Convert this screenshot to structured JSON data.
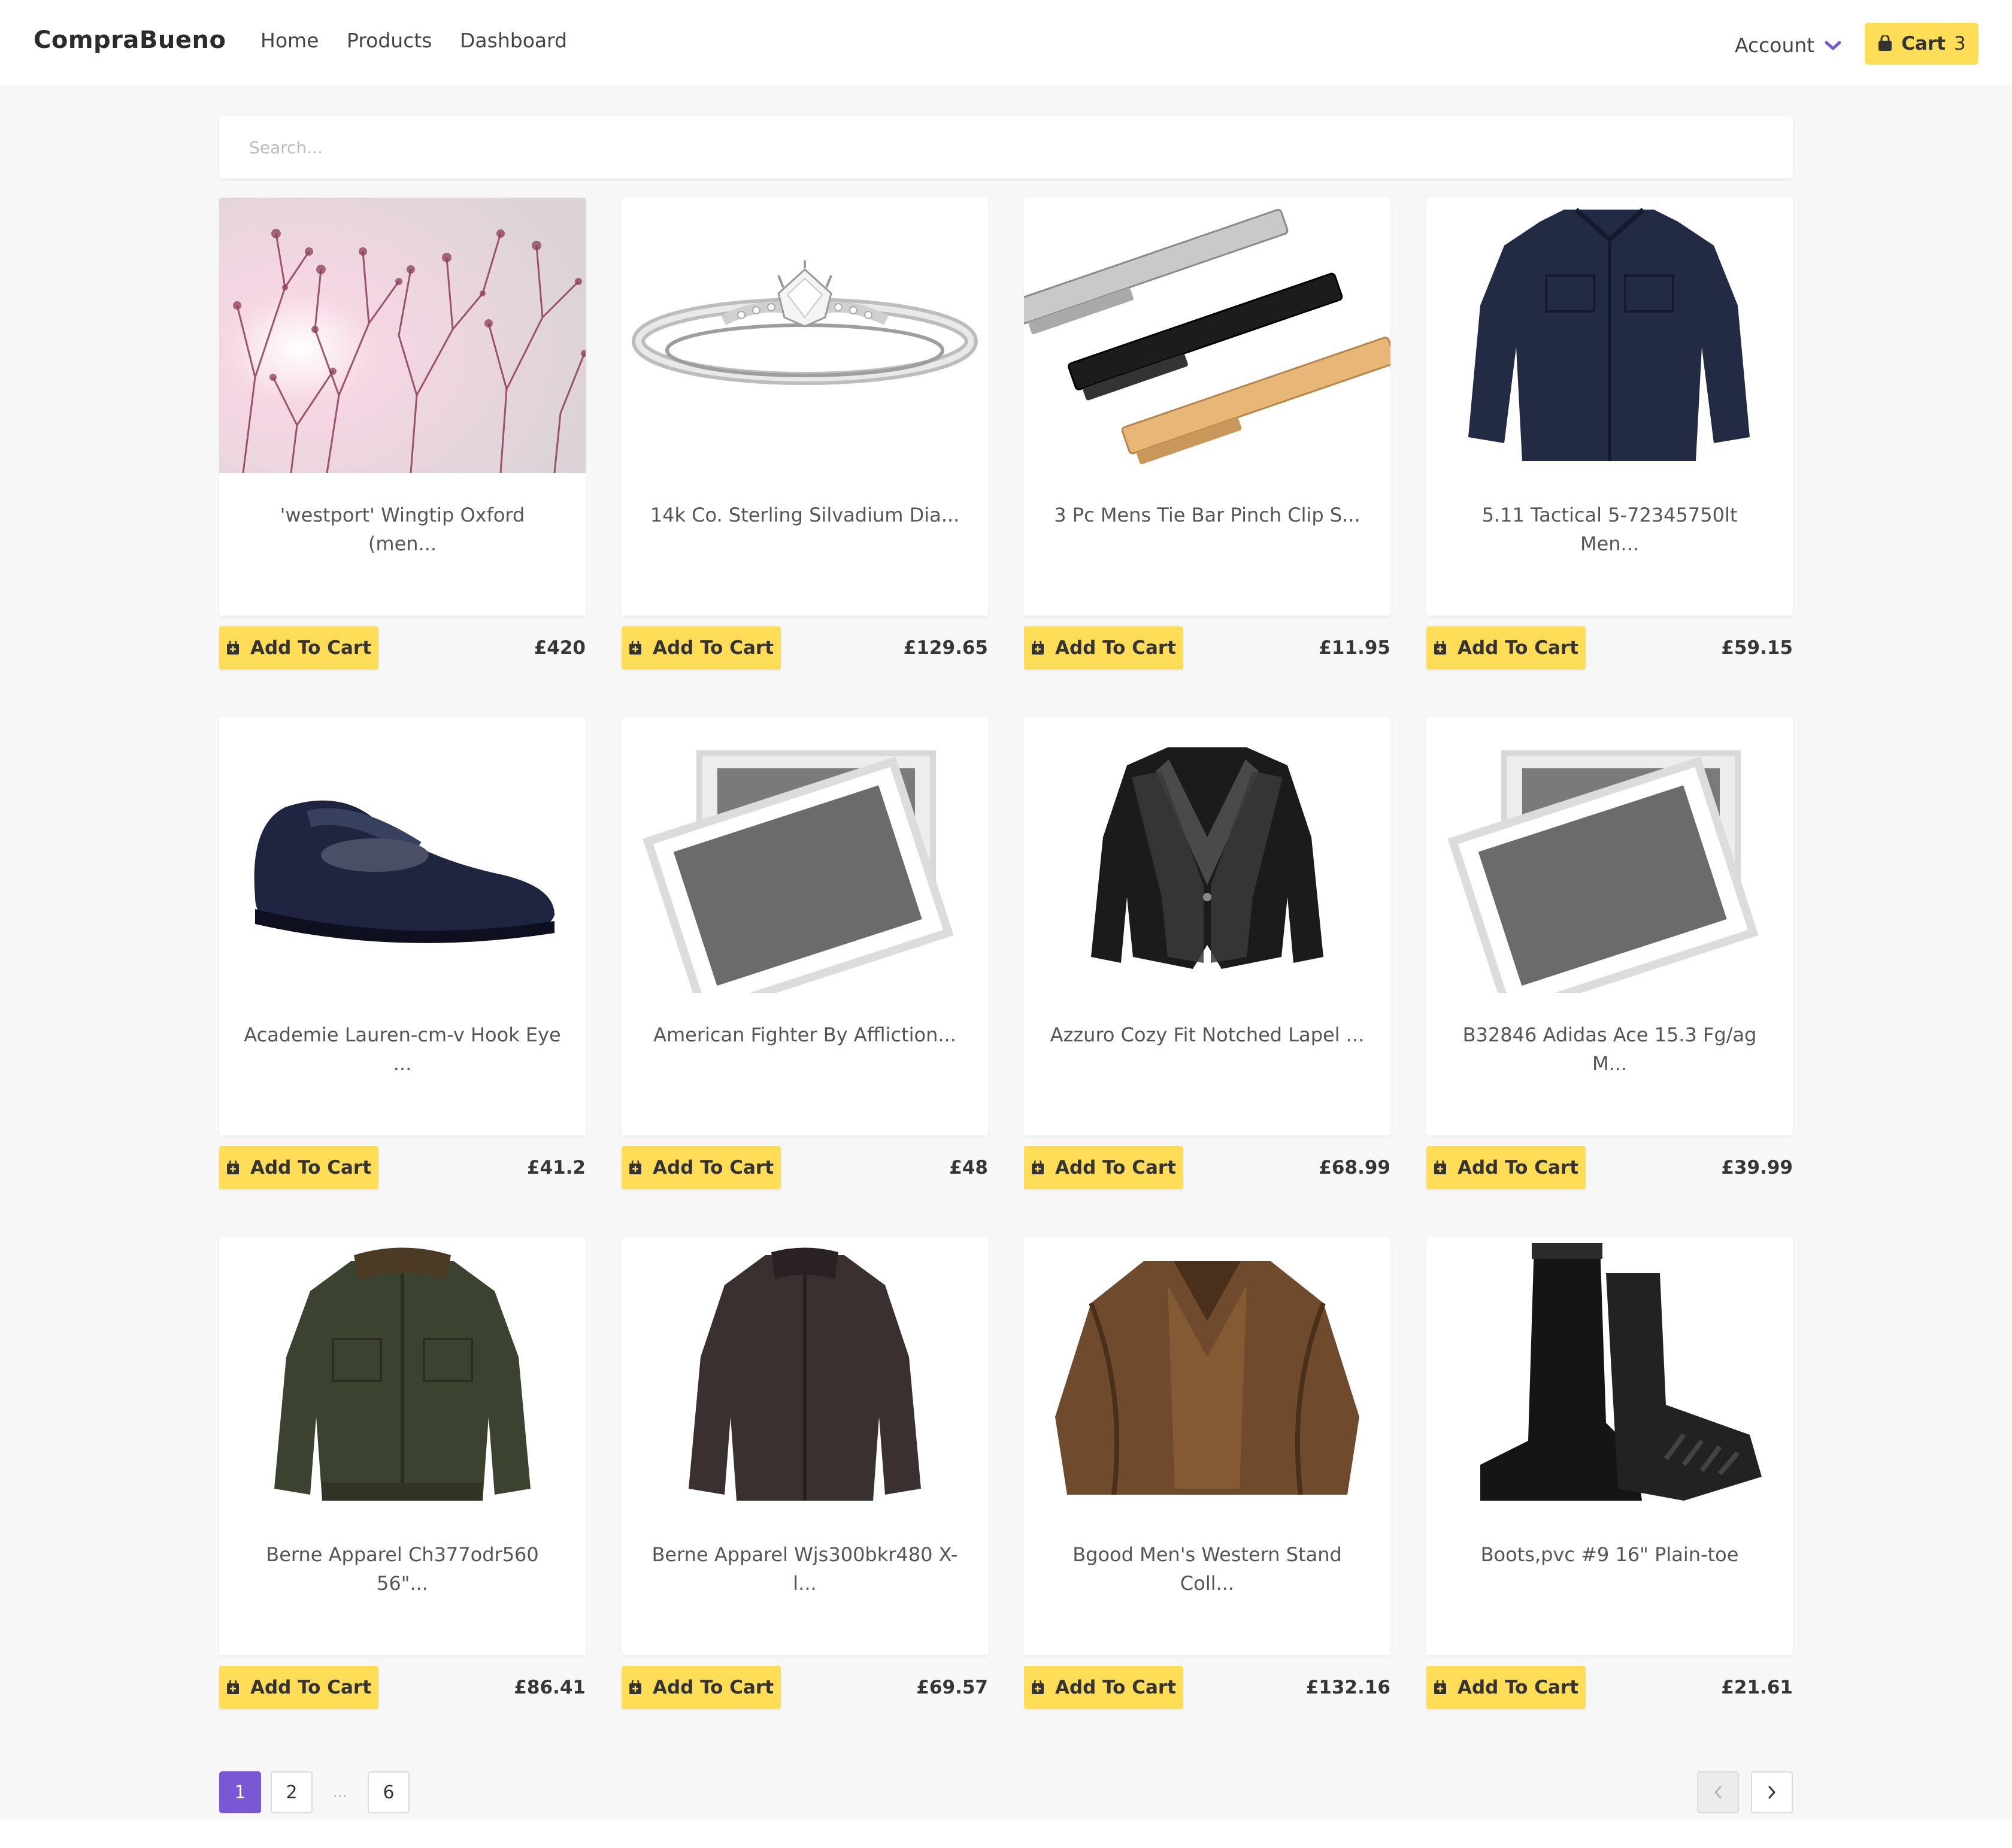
{
  "nav": {
    "brand": "CompraBueno",
    "links": [
      "Home",
      "Products",
      "Dashboard"
    ],
    "account_label": "Account",
    "cart_label": "Cart",
    "cart_count": "3",
    "accent_color": "#7957d5",
    "button_color": "#ffdd57"
  },
  "search": {
    "placeholder": "Search..."
  },
  "add_to_cart_label": "Add To Cart",
  "products": [
    {
      "title": "'westport' Wingtip Oxford (men...",
      "price": "£420",
      "image": "pink-branches-photo"
    },
    {
      "title": "14k Co. Sterling Silvadium Dia...",
      "price": "£129.65",
      "image": "diamond-ring"
    },
    {
      "title": "3 Pc Mens Tie Bar Pinch Clip S...",
      "price": "£11.95",
      "image": "tie-bars"
    },
    {
      "title": "5.11 Tactical 5-72345750lt Men...",
      "price": "£59.15",
      "image": "navy-shirt"
    },
    {
      "title": "Academie Lauren-cm-v Hook Eye ...",
      "price": "£41.2",
      "image": "navy-shoe"
    },
    {
      "title": "American Fighter By Affliction...",
      "price": "£48",
      "image": "placeholder-photo"
    },
    {
      "title": "Azzuro Cozy Fit Notched Lapel ...",
      "price": "£68.99",
      "image": "black-blazer"
    },
    {
      "title": "B32846 Adidas Ace 15.3 Fg/ag M...",
      "price": "£39.99",
      "image": "placeholder-photo"
    },
    {
      "title": "Berne Apparel Ch377odr560 56\"...",
      "price": "£86.41",
      "image": "green-jacket"
    },
    {
      "title": "Berne Apparel Wjs300bkr480 X-l...",
      "price": "£69.57",
      "image": "dark-jacket"
    },
    {
      "title": "Bgood Men's Western Stand Coll...",
      "price": "£132.16",
      "image": "brown-jacket"
    },
    {
      "title": "Boots,pvc #9 16\" Plain-toe",
      "price": "£21.61",
      "image": "rubber-boots"
    }
  ],
  "pagination": {
    "pages": [
      "1",
      "2",
      "…",
      "6"
    ],
    "current": "1"
  }
}
